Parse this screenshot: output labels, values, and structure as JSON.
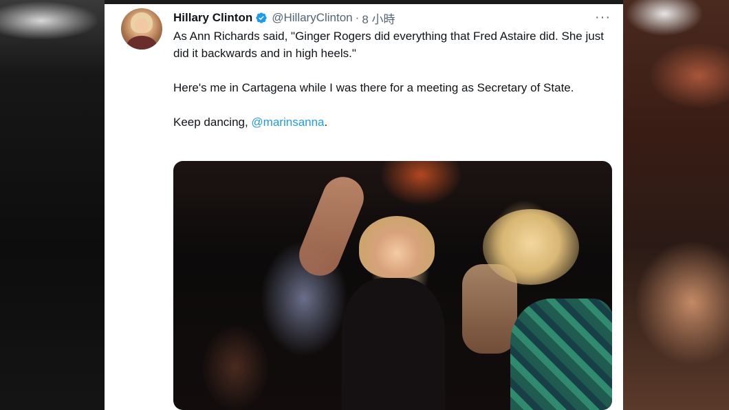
{
  "tweet": {
    "author_name": "Hillary Clinton",
    "handle": "@HillaryClinton",
    "separator": "·",
    "timestamp": "8 小時",
    "more_label": "···",
    "verified_icon": "verified-badge-icon",
    "accent_color": "#1d9bf0",
    "paragraphs": {
      "p1": "As Ann Richards said, \"Ginger Rogers did everything that Fred Astaire did. She just did it backwards and in high heels.\"",
      "p2": "Here's me in Cartagena while I was there for a meeting as Secretary of State.",
      "p3_prefix": "Keep dancing, ",
      "p3_mention": "@marinsanna",
      "p3_suffix": "."
    }
  }
}
